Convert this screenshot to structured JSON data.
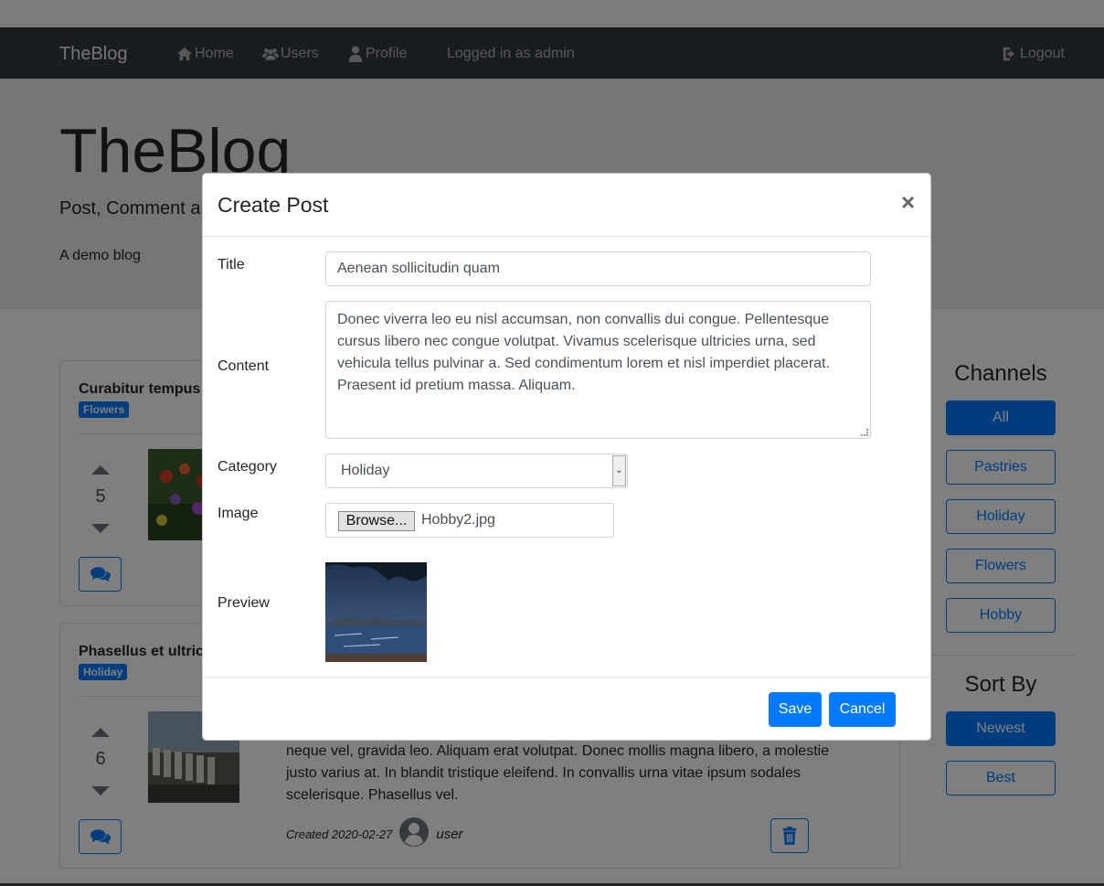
{
  "navbar": {
    "brand": "TheBlog",
    "home_label": "Home",
    "users_label": "Users",
    "profile_label": "Profile",
    "logged_in_text": "Logged in as admin",
    "logout_label": "Logout",
    "home_icon": "home-icon",
    "users_icon": "users-icon",
    "profile_icon": "user-icon",
    "logout_icon": "sign-out-icon"
  },
  "jumbotron": {
    "title": "TheBlog",
    "lead": "Post, Comment and",
    "description": "A demo blog"
  },
  "posts": [
    {
      "title": "Curabitur tempus",
      "category": "Flowers",
      "votes": "5",
      "thumbnail": "tulips-photo"
    },
    {
      "title": "Phasellus et ultric",
      "category": "Holiday",
      "votes": "6",
      "thumbnail": "beach-chairs-photo",
      "text": "neque vel, gravida leo. Aliquam erat volutpat. Donec mollis magna libero, a molestie justo varius at. In blandit tristique eleifend. In convallis urna vitae ipsum sodales scelerisque. Phasellus vel.",
      "created": "Created 2020-02-27",
      "author": "user"
    }
  ],
  "sidebar": {
    "channels_heading": "Channels",
    "channels": [
      "All",
      "Pastries",
      "Holiday",
      "Flowers",
      "Hobby"
    ],
    "active_channel": "All",
    "sort_heading": "Sort By",
    "sort_options": [
      "Newest",
      "Best"
    ],
    "active_sort": "Newest"
  },
  "modal": {
    "title": "Create Post",
    "close_symbol": "×",
    "title_label": "Title",
    "title_value": "Aenean sollicitudin quam",
    "content_label": "Content",
    "content_value": "Donec viverra leo eu nisl accumsan, non convallis dui congue. Pellentesque cursus libero nec congue volutpat. Vivamus scelerisque ultricies urna, sed vehicula tellus pulvinar a. Sed condimentum lorem et nisl imperdiet placerat. Praesent id pretium massa. Aliquam.",
    "category_label": "Category",
    "category_value": "Holiday",
    "image_label": "Image",
    "browse_label": "Browse...",
    "file_name": "Hobby2.jpg",
    "preview_label": "Preview",
    "save_label": "Save",
    "cancel_label": "Cancel"
  },
  "colors": {
    "primary": "#007bff",
    "navbar": "#343a40",
    "jumbotron": "#e9ecef"
  }
}
